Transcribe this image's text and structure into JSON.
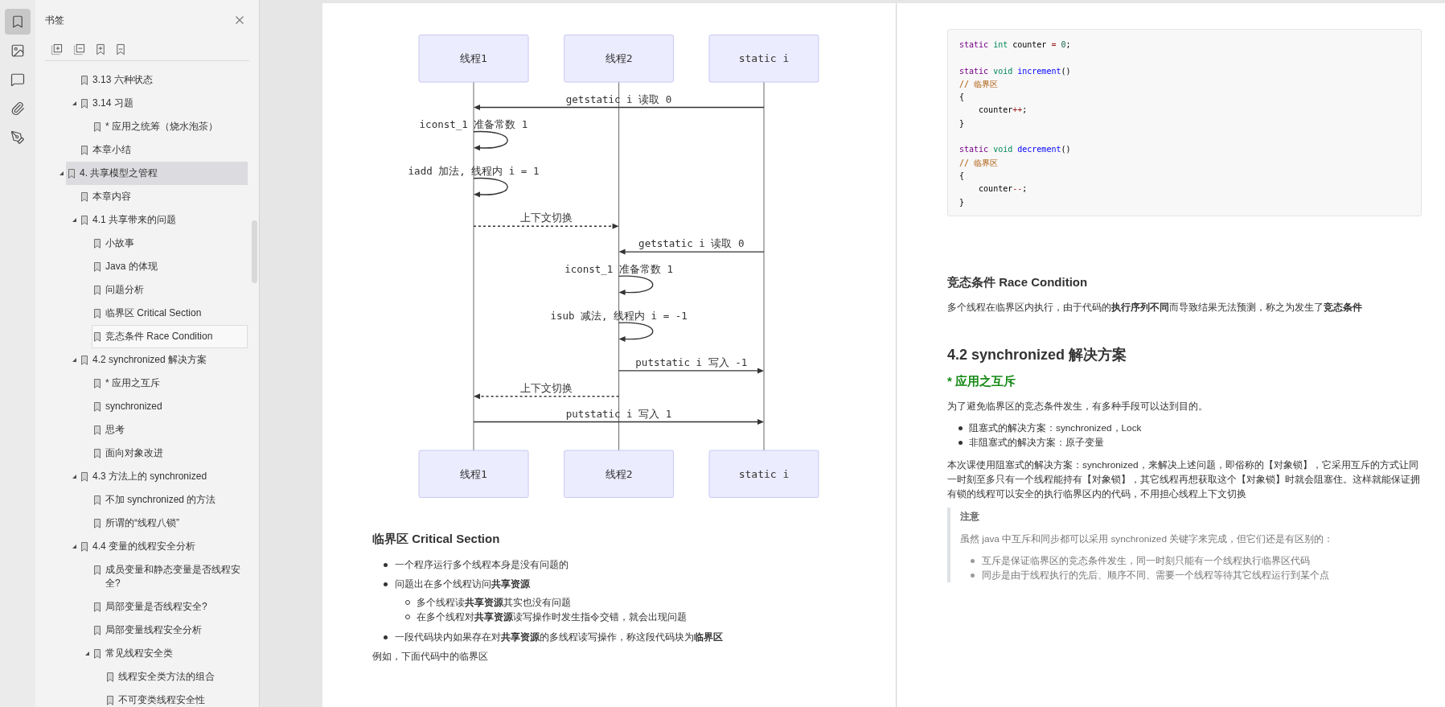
{
  "rail": [
    {
      "selected": true
    },
    {
      "selected": false
    },
    {
      "selected": false
    },
    {
      "selected": false
    },
    {
      "selected": false
    }
  ],
  "bookmarks": {
    "title": "书签",
    "items": [
      {
        "children": [
          {
            "label": "3.13 六种状态",
            "selected": false,
            "hovered": false
          },
          {
            "label": "3.14 习题",
            "selected": false,
            "hovered": false,
            "expanded": true,
            "children": [
              {
                "label": "* 应用之统筹（烧水泡茶）",
                "selected": false,
                "hovered": false
              }
            ]
          },
          {
            "label": "本章小结",
            "selected": false,
            "hovered": false
          }
        ]
      },
      {
        "label": "4. 共享模型之管程",
        "selected": true,
        "hovered": false,
        "expanded": true,
        "children": [
          {
            "label": "本章内容",
            "selected": false,
            "hovered": false
          },
          {
            "label": "4.1 共享带来的问题",
            "selected": false,
            "hovered": false,
            "expanded": true,
            "children": [
              {
                "label": "小故事",
                "selected": false,
                "hovered": false
              },
              {
                "label": "Java 的体现",
                "selected": false,
                "hovered": false
              },
              {
                "label": "问题分析",
                "selected": false,
                "hovered": false
              },
              {
                "label": "临界区 Critical Section",
                "selected": false,
                "hovered": false
              },
              {
                "label": "竞态条件 Race Condition",
                "selected": false,
                "hovered": true
              }
            ]
          },
          {
            "label": "4.2 synchronized 解决方案",
            "selected": false,
            "hovered": false,
            "expanded": true,
            "children": [
              {
                "label": "* 应用之互斥",
                "selected": false,
                "hovered": false
              },
              {
                "label": "synchronized",
                "selected": false,
                "hovered": false
              },
              {
                "label": "思考",
                "selected": false,
                "hovered": false
              },
              {
                "label": "面向对象改进",
                "selected": false,
                "hovered": false
              }
            ]
          },
          {
            "label": "4.3 方法上的 synchronized",
            "selected": false,
            "hovered": false,
            "expanded": true,
            "children": [
              {
                "label": "不加 synchronized 的方法",
                "selected": false,
                "hovered": false
              },
              {
                "label": "所谓的“线程八锁”",
                "selected": false,
                "hovered": false
              }
            ]
          },
          {
            "label": "4.4 变量的线程安全分析",
            "selected": false,
            "hovered": false,
            "expanded": true,
            "children": [
              {
                "label": "成员变量和静态变量是否线程安全?",
                "selected": false,
                "hovered": false
              },
              {
                "label": "局部变量是否线程安全?",
                "selected": false,
                "hovered": false
              },
              {
                "label": "局部变量线程安全分析",
                "selected": false,
                "hovered": false
              },
              {
                "label": "常见线程安全类",
                "selected": false,
                "hovered": false,
                "expanded": true,
                "children": [
                  {
                    "label": "线程安全类方法的组合",
                    "selected": false,
                    "hovered": false
                  },
                  {
                    "label": "不可变类线程安全性",
                    "selected": false,
                    "hovered": false
                  }
                ]
              }
            ]
          }
        ]
      }
    ]
  },
  "page_1": {
    "diagram": {
      "participants": [
        "线程1",
        "线程2",
        "static i"
      ],
      "participants_bottom": [
        "线程1",
        "线程2",
        "static i"
      ],
      "messages": [
        {
          "kind": "solid",
          "label": "getstatic i 读取 0",
          "gaps": [
            {
              "kind": "leftward"
            },
            {
              "kind": "leftward"
            }
          ]
        },
        {
          "kind": "solid",
          "label": "iconst_1 准备常数 1",
          "gaps": [
            {
              "kind": "loop"
            },
            {
              "kind": "none"
            }
          ]
        },
        {
          "kind": "solid",
          "label": "iadd 加法, 线程内 i = 1",
          "gaps": [
            {
              "kind": "loop"
            },
            {
              "kind": "none"
            }
          ]
        },
        {
          "kind": "dashed",
          "label": "上下文切换",
          "gaps": [
            {
              "kind": "rightward"
            },
            {
              "kind": "none"
            }
          ]
        },
        {
          "kind": "solid",
          "label": "getstatic i 读取 0",
          "gaps": [
            {
              "kind": "none"
            },
            {
              "kind": "leftward"
            }
          ]
        },
        {
          "kind": "solid",
          "label": "iconst_1 准备常数 1",
          "gaps": [
            {
              "kind": "none"
            },
            {
              "kind": "loop"
            }
          ]
        },
        {
          "kind": "solid",
          "label": "isub 减法, 线程内 i = -1",
          "gaps": [
            {
              "kind": "none"
            },
            {
              "kind": "loop"
            }
          ]
        },
        {
          "kind": "solid",
          "label": "putstatic i 写入 -1",
          "gaps": [
            {
              "kind": "none"
            },
            {
              "kind": "rightward"
            }
          ]
        },
        {
          "kind": "dashed",
          "label": "上下文切换",
          "gaps": [
            {
              "kind": "leftward"
            },
            {
              "kind": "none"
            }
          ]
        },
        {
          "kind": "solid",
          "label": "putstatic i 写入 1",
          "gaps": [
            {
              "kind": "rightward"
            },
            {
              "kind": "rightward"
            }
          ]
        }
      ]
    },
    "heading": "临界区 Critical Section",
    "bullets": [
      {
        "text": "一个程序运行多个线程本身是没有问题的"
      },
      {
        "text": "问题出在多个线程访问**共享资源**",
        "children": [
          {
            "text": "多个线程读**共享资源**其实也没有问题"
          },
          {
            "text": "在多个线程对**共享资源**读写操作时发生指令交错，就会出现问题"
          }
        ]
      },
      {
        "text": "一段代码块内如果存在对**共享资源**的多线程读写操作，称这段代码块为**临界区**"
      }
    ],
    "paragraph": "例如，下面代码中的临界区"
  },
  "page_2": {
    "code": {
      "blocks": [
        [
          [
            {
              "kind": "keyword",
              "text": "static"
            },
            {
              "kind": "type",
              "text": " int"
            },
            {
              "kind": "plain",
              "text": " counter "
            },
            {
              "kind": "operator",
              "text": "="
            },
            {
              "kind": "number",
              "text": " 0"
            },
            {
              "kind": "plain",
              "text": ";"
            }
          ]
        ],
        [
          [
            {
              "kind": "keyword",
              "text": "static"
            },
            {
              "kind": "type",
              "text": " void"
            },
            {
              "kind": "def",
              "text": " increment"
            },
            {
              "kind": "plain",
              "text": "()"
            }
          ],
          [
            {
              "kind": "comment",
              "text": "// 临界区"
            }
          ],
          [
            {
              "kind": "plain",
              "text": "{"
            }
          ],
          [
            {
              "kind": "plain",
              "text": "    counter"
            },
            {
              "kind": "operator",
              "text": "++"
            },
            {
              "kind": "plain",
              "text": ";"
            }
          ],
          [
            {
              "kind": "plain",
              "text": "}"
            }
          ]
        ],
        [
          [
            {
              "kind": "keyword",
              "text": "static"
            },
            {
              "kind": "type",
              "text": " void"
            },
            {
              "kind": "def",
              "text": " decrement"
            },
            {
              "kind": "plain",
              "text": "()"
            }
          ],
          [
            {
              "kind": "comment",
              "text": "// 临界区"
            }
          ],
          [
            {
              "kind": "plain",
              "text": "{"
            }
          ],
          [
            {
              "kind": "plain",
              "text": "    counter"
            },
            {
              "kind": "operator",
              "text": "--"
            },
            {
              "kind": "plain",
              "text": ";"
            }
          ],
          [
            {
              "kind": "plain",
              "text": "}"
            }
          ]
        ]
      ]
    },
    "heading": "竞态条件 Race Condition",
    "paragraph": "多个线程在临界区内执行，由于代码的**执行序列不同**而导致结果无法预测，称之为发生了**竞态条件**",
    "section_title": "4.2 synchronized 解决方案",
    "subsection_title": "* 应用之互斥",
    "intro": "为了避免临界区的竞态条件发生，有多种手段可以达到目的。",
    "bullets": [
      "阻塞式的解决方案：synchronized，Lock",
      "非阻塞式的解决方案：原子变量"
    ],
    "body": "本次课使用阻塞式的解决方案：synchronized，来解决上述问题，即俗称的【对象锁】，它采用互斥的方式让同一时刻至多只有一个线程能持有【对象锁】，其它线程再想获取这个【对象锁】时就会阻塞住。这样就能保证拥有锁的线程可以安全的执行临界区内的代码，不用担心线程上下文切换",
    "note": {
      "title": "注意",
      "text": "虽然 java 中互斥和同步都可以采用 synchronized 关键字来完成，但它们还是有区别的：",
      "bullets": [
        "互斥是保证临界区的竞态条件发生，同一时刻只能有一个线程执行临界区代码",
        "同步是由于线程执行的先后、顺序不同、需要一个线程等待其它线程运行到某个点"
      ]
    }
  }
}
